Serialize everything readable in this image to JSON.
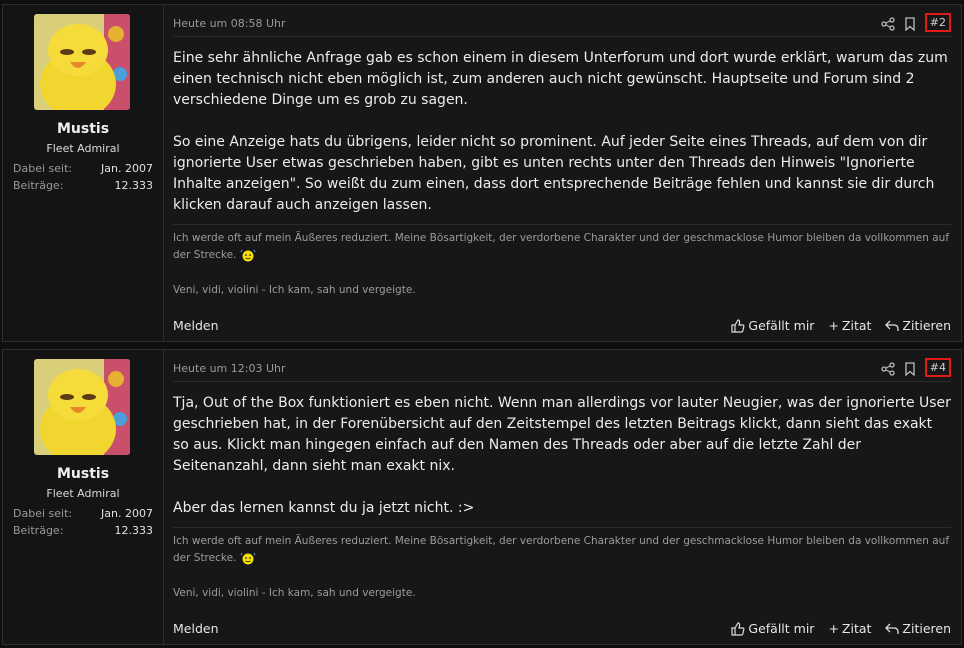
{
  "posts": [
    {
      "user": {
        "name": "Mustis",
        "title": "Fleet Admiral",
        "joined_label": "Dabei seit:",
        "joined": "Jan. 2007",
        "posts_label": "Beiträge:",
        "posts": "12.333"
      },
      "date": "Heute um 08:58 Uhr",
      "number": "#2",
      "paragraphs": [
        "Eine sehr ähnliche Anfrage gab es schon einem in diesem Unterforum und dort wurde erklärt, warum das zum einen technisch nicht eben möglich ist, zum anderen auch nicht gewünscht. Hauptseite und Forum sind 2 verschiedene Dinge um es grob zu sagen.",
        "So eine Anzeige hats du übrigens, leider nicht so prominent. Auf jeder Seite eines Threads, auf dem von dir ignorierte User etwas geschrieben haben, gibt es unten rechts unter den Threads den Hinweis \"Ignorierte Inhalte anzeigen\". So weißt du zum einen, dass dort entsprechende Beiträge fehlen und kannst sie dir durch klicken darauf auch anzeigen lassen."
      ],
      "signature": {
        "line1": "Ich werde oft auf mein Äußeres reduziert. Meine Bösartigkeit, der verdorbene Charakter und der geschmacklose Humor bleiben da vollkommen auf der Strecke.",
        "line2": "Veni, vidi, violini - Ich kam, sah und vergeigte."
      },
      "report": "Melden",
      "like": "Gefällt mir",
      "quote": "Zitat",
      "reply": "Zitieren"
    },
    {
      "user": {
        "name": "Mustis",
        "title": "Fleet Admiral",
        "joined_label": "Dabei seit:",
        "joined": "Jan. 2007",
        "posts_label": "Beiträge:",
        "posts": "12.333"
      },
      "date": "Heute um 12:03 Uhr",
      "number": "#4",
      "paragraphs": [
        "Tja, Out of the Box funktioniert es eben nicht. Wenn man allerdings vor lauter Neugier, was der ignorierte User geschrieben hat, in der Forenübersicht auf den Zeitstempel des letzten Beitrags klickt, dann sieht das exakt so aus. Klickt man hingegen einfach auf den Namen des Threads oder aber auf die letzte Zahl der Seitenanzahl, dann sieht man exakt nix.",
        "Aber das lernen kannst du ja jetzt nicht. :>"
      ],
      "signature": {
        "line1": "Ich werde oft auf mein Äußeres reduziert. Meine Bösartigkeit, der verdorbene Charakter und der geschmacklose Humor bleiben da vollkommen auf der Strecke.",
        "line2": "Veni, vidi, violini - Ich kam, sah und vergeigte."
      },
      "report": "Melden",
      "like": "Gefällt mir",
      "quote": "Zitat",
      "reply": "Zitieren"
    }
  ],
  "colors": {
    "highlight": "#e01b1b",
    "background": "#171718"
  },
  "icons": [
    "share-icon",
    "bookmark-icon",
    "thumbs-up-icon",
    "plus-icon",
    "reply-icon",
    "smiley-icon"
  ]
}
